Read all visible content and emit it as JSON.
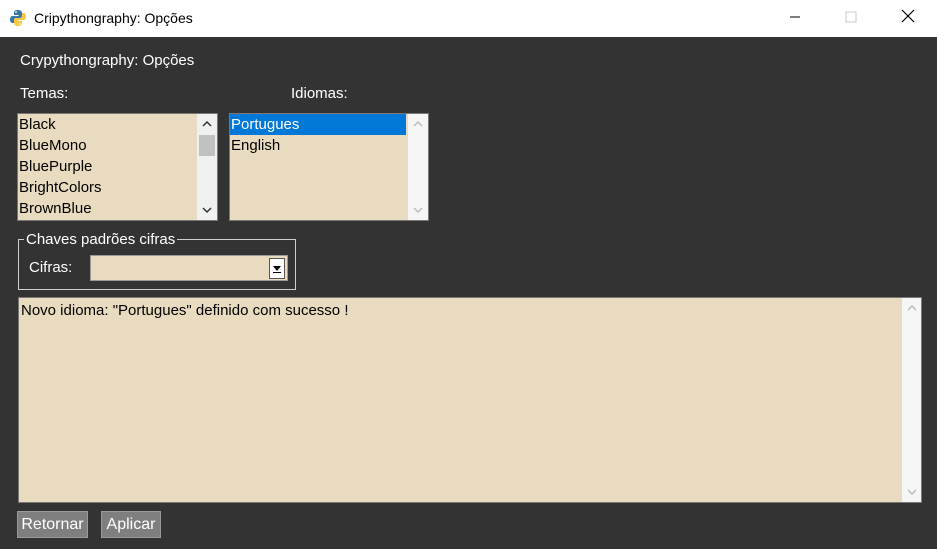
{
  "window": {
    "title": "Cripythongraphy: Opções",
    "icon": "python-icon",
    "controls": [
      "minimize-icon",
      "maximize-icon",
      "close-icon"
    ]
  },
  "header": {
    "text": "Crypythongraphy: Opções"
  },
  "themes": {
    "label": "Temas:",
    "items": [
      "Black",
      "BlueMono",
      "BluePurple",
      "BrightColors",
      "BrownBlue"
    ]
  },
  "languages": {
    "label": "Idiomas:",
    "items": [
      "Portugues",
      "English"
    ],
    "selected": "Portugues"
  },
  "cipher_frame": {
    "legend": "Chaves padrões cifras",
    "label": "Cifras:",
    "value": ""
  },
  "output": {
    "text": "Novo idioma: \"Portugues\" definido com sucesso !"
  },
  "buttons": {
    "return_label": "Retornar",
    "apply_label": "Aplicar"
  },
  "colors": {
    "background": "#333333",
    "field": "#e8dbc0",
    "selection": "#0078d7",
    "button": "#7f7f7f"
  }
}
